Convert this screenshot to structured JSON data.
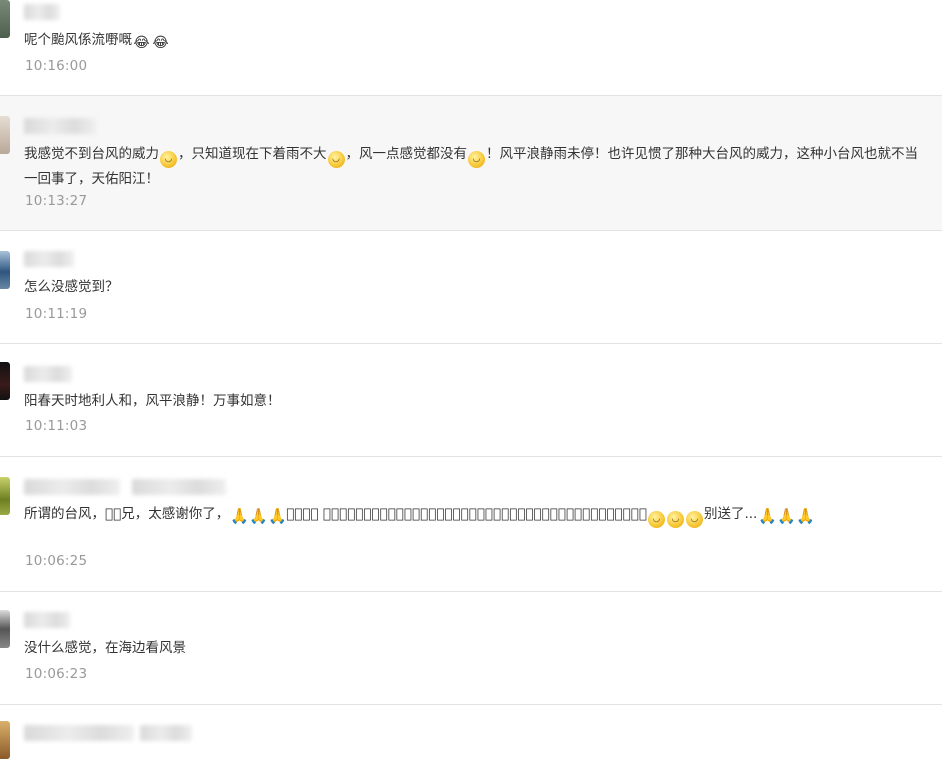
{
  "comments": [
    {
      "text_parts": [
        "呢个颱风係流嘢嘅",
        "",
        ""
      ],
      "time": "10:16:00",
      "avatar_color": "#5a6b5a"
    },
    {
      "text_parts": [
        "我感觉不到台风的威力",
        "，只知道现在下着雨不大",
        "，风一点感觉都没有",
        "！风平浪静雨未停！也许见惯了那种大台风的威力，这种小台风也就不当一回事了，天佑阳江！"
      ],
      "time": "10:13:27",
      "avatar_color": "#c8b8a8"
    },
    {
      "text": "怎么没感觉到？",
      "time": "10:11:19",
      "avatar_color": "#3b5f8a"
    },
    {
      "text": "阳春天时地利人和，风平浪静！万事如意！",
      "time": "10:11:03",
      "avatar_color": "#1e1e1e"
    },
    {
      "text_parts": [
        "所谓的台风，𩙪𩙪兄，太感谢你了，",
        "𩙪𩙪兄， 阳江贵地不是你想来就来地方，谢谢你的巡回，你到别的地方去吧！以后你不再来阳江了，",
        "别送了..."
      ],
      "time": "10:06:25",
      "avatar_color": "#8a9a3a"
    },
    {
      "text": "没什么感觉，在海边看风景",
      "time": "10:06:23",
      "avatar_color": "#4a4a4a"
    }
  ],
  "icons": {
    "laugh_cry": "😂",
    "pray": "🙏",
    "face": "☺"
  }
}
